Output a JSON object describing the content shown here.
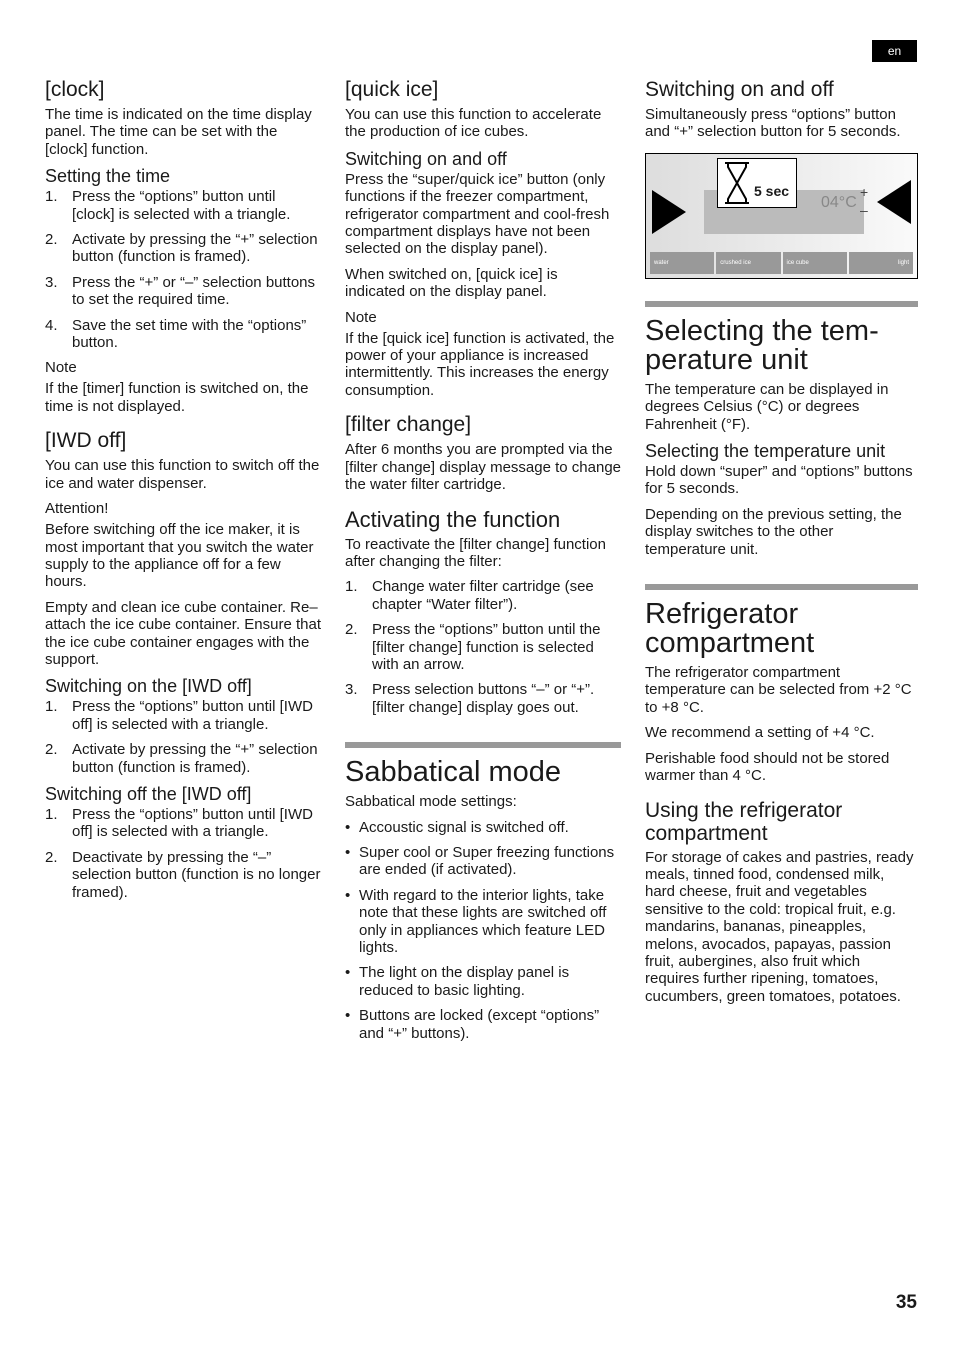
{
  "lang": "en",
  "page_number": "35",
  "col1": {
    "clock": {
      "title": "[clock]",
      "text": "The time is indicated on the time dis­play panel. The time can be set with the [clock] function.",
      "sub": "Setting the time",
      "steps": [
        "Press the “options” button until [clock] is selected with a triangle.",
        "Activate by pressing the “+” selection button (function is framed).",
        "Press the “+” or “–” selection buttons to set the required time.",
        "Save the set time with the “options” button."
      ],
      "note_label": "Note",
      "note": "If the [timer] function is switched on, the time is not displayed."
    },
    "iwd": {
      "title": "[IWD off]",
      "text": "You can use this function to switch off the ice and water dispenser.",
      "attention_label": "Attention!",
      "attention": "Before switching off the ice maker, it is most important that you switch the water supply to the appliance off for a few hours.",
      "text2": "Empty and clean ice cube container. Re–attach the ice cube container. Ensure that the ice cube container engages with the support.",
      "on_title": "Switching on the [IWD off]",
      "on_steps": [
        "Press the “options” button until [IWD off] is selected with a triangle.",
        "Activate by pressing the “+” selection button (function is framed)."
      ],
      "off_title": "Switching off the [IWD off]",
      "off_steps": [
        "Press the “options” button until [IWD off] is selected with a triangle.",
        "Deactivate by pressing the “–” selection button (function is no longer framed)."
      ]
    }
  },
  "col2": {
    "quick": {
      "title": "[quick ice]",
      "text": "You can use this function to accelerate the production of ice cubes.",
      "sub": "Switching on and off",
      "text2": "Press the “super/quick ice” button (only functions if the freezer compartment, refrigerator compartment and cool-fresh compartment displays have not been selected on the display panel).",
      "text3": "When switched on, [quick ice] is indicated on the display panel.",
      "note_label": "Note",
      "note": "If the [quick ice] function is activated, the power of your appliance is increased intermittently. This increases the energy consumption."
    },
    "filter": {
      "title": "[filter change]",
      "text": "After 6 months you are prompted via the [filter change] display message to change the water filter cartridge.",
      "sub": "Activating the function",
      "text2": "To reactivate the [filter change] function after changing the filter:",
      "steps": [
        "Change water filter cartridge (see chapter “Water filter”).",
        "Press the “options” button until the [filter change] function is selected with an arrow.",
        "Press selection buttons “–” or “+”. [filter change] display goes out."
      ]
    },
    "sabbatical": {
      "title": "Sabbatical mode",
      "intro": "Sabbatical mode settings:",
      "bullets": [
        "Accoustic signal is switched off.",
        "Super cool or Super freezing functions are ended (if activated).",
        "With regard to the interior lights, take note that these lights are switched off only in appliances which feature LED lights.",
        "The light on the display panel is reduced to basic lighting.",
        "Buttons are locked (except “options” and “+” buttons)."
      ]
    }
  },
  "col3": {
    "onoff": {
      "title": "Switching on and off",
      "text": "Simultaneously press “options” button and “+” selection button for 5 seconds."
    },
    "panel": {
      "timer": "5 sec",
      "temp": "04°C",
      "buttons": [
        "water",
        "crushed ice",
        "ice cube",
        "light"
      ],
      "plus": "+",
      "minus": "–"
    },
    "unit": {
      "title": "Selecting the tem­perature unit",
      "text": "The temperature can be displayed in degrees Celsius (°C) or degrees Fahrenheit (°F).",
      "sub": "Selecting the temperature unit",
      "text2": "Hold down “super” and “options” buttons for 5 seconds.",
      "text3": "Depending on the previous setting, the display switches to the other temperature unit."
    },
    "fridge": {
      "title": "Refrigerator compartment",
      "text": "The refrigerator compartment temperature can be selected from +2 °C to +8 °C.",
      "text2": "We recommend a setting of +4 °C.",
      "text3": "Perishable food should not be stored warmer than 4 °C.",
      "sub": "Using the refrigerator compartment",
      "text4": "For storage of cakes and pastries, ready meals, tinned food, condensed milk, hard cheese, fruit and vegetables sensitive to the cold: tropical fruit, e.g. mandarins, bananas, pineapples, melons, avocados, papayas, passion fruit, aubergines, also fruit which requires further ripening, tomatoes, cucumbers, green tomatoes, potatoes."
    }
  }
}
